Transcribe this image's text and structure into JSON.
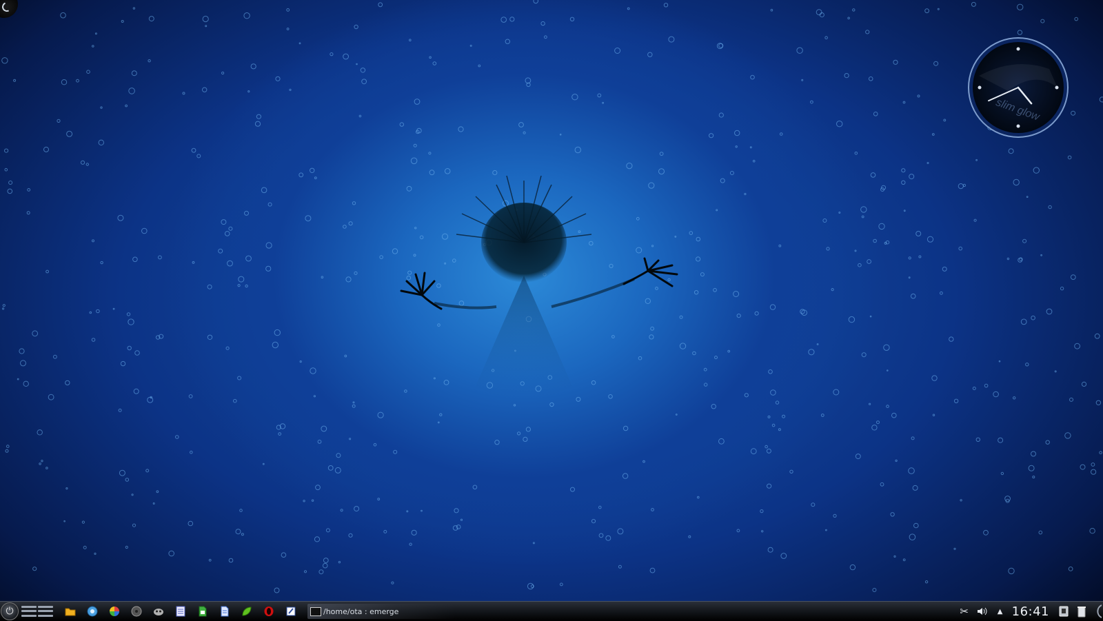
{
  "desktop": {
    "clock_widget": {
      "brand_text": "slim glow",
      "hour": 16,
      "minute": 41
    }
  },
  "taskbar": {
    "launcher": {
      "icon": "kde-launcher-icon"
    },
    "pager": {
      "desktops": 2
    },
    "quick_launch": [
      {
        "name": "file-manager",
        "icon": "folder-icon",
        "color": "#f0b020"
      },
      {
        "name": "web-browser",
        "icon": "globe-icon",
        "color": "#4aa0e0"
      },
      {
        "name": "image-viewer",
        "icon": "pinwheel-icon",
        "color": "#e04040"
      },
      {
        "name": "media-player",
        "icon": "disc-icon",
        "color": "#666666"
      },
      {
        "name": "chat-client",
        "icon": "pidgin-icon",
        "color": "#b0b0b0"
      },
      {
        "name": "calendar",
        "icon": "calendar-icon",
        "color": "#5060c0"
      },
      {
        "name": "spreadsheet",
        "icon": "spreadsheet-icon",
        "color": "#40b040"
      },
      {
        "name": "text-document",
        "icon": "document-icon",
        "color": "#4070d0"
      },
      {
        "name": "feed-reader",
        "icon": "leaf-icon",
        "color": "#60c020"
      },
      {
        "name": "opera-browser",
        "icon": "opera-icon",
        "color": "#d01010"
      },
      {
        "name": "text-editor",
        "icon": "pen-icon",
        "color": "#3050a0"
      }
    ],
    "task": {
      "label": "/home/ota : emerge",
      "icon": "terminal-icon"
    },
    "tray": {
      "items": [
        {
          "name": "klipper",
          "icon": "scissors-icon"
        },
        {
          "name": "volume",
          "icon": "speaker-icon"
        },
        {
          "name": "tray-expander",
          "icon": "triangle-up-icon"
        }
      ],
      "time": "16:41",
      "trailing": [
        {
          "name": "device-notifier",
          "icon": "usb-device-icon"
        },
        {
          "name": "trash",
          "icon": "trash-icon"
        }
      ]
    }
  }
}
